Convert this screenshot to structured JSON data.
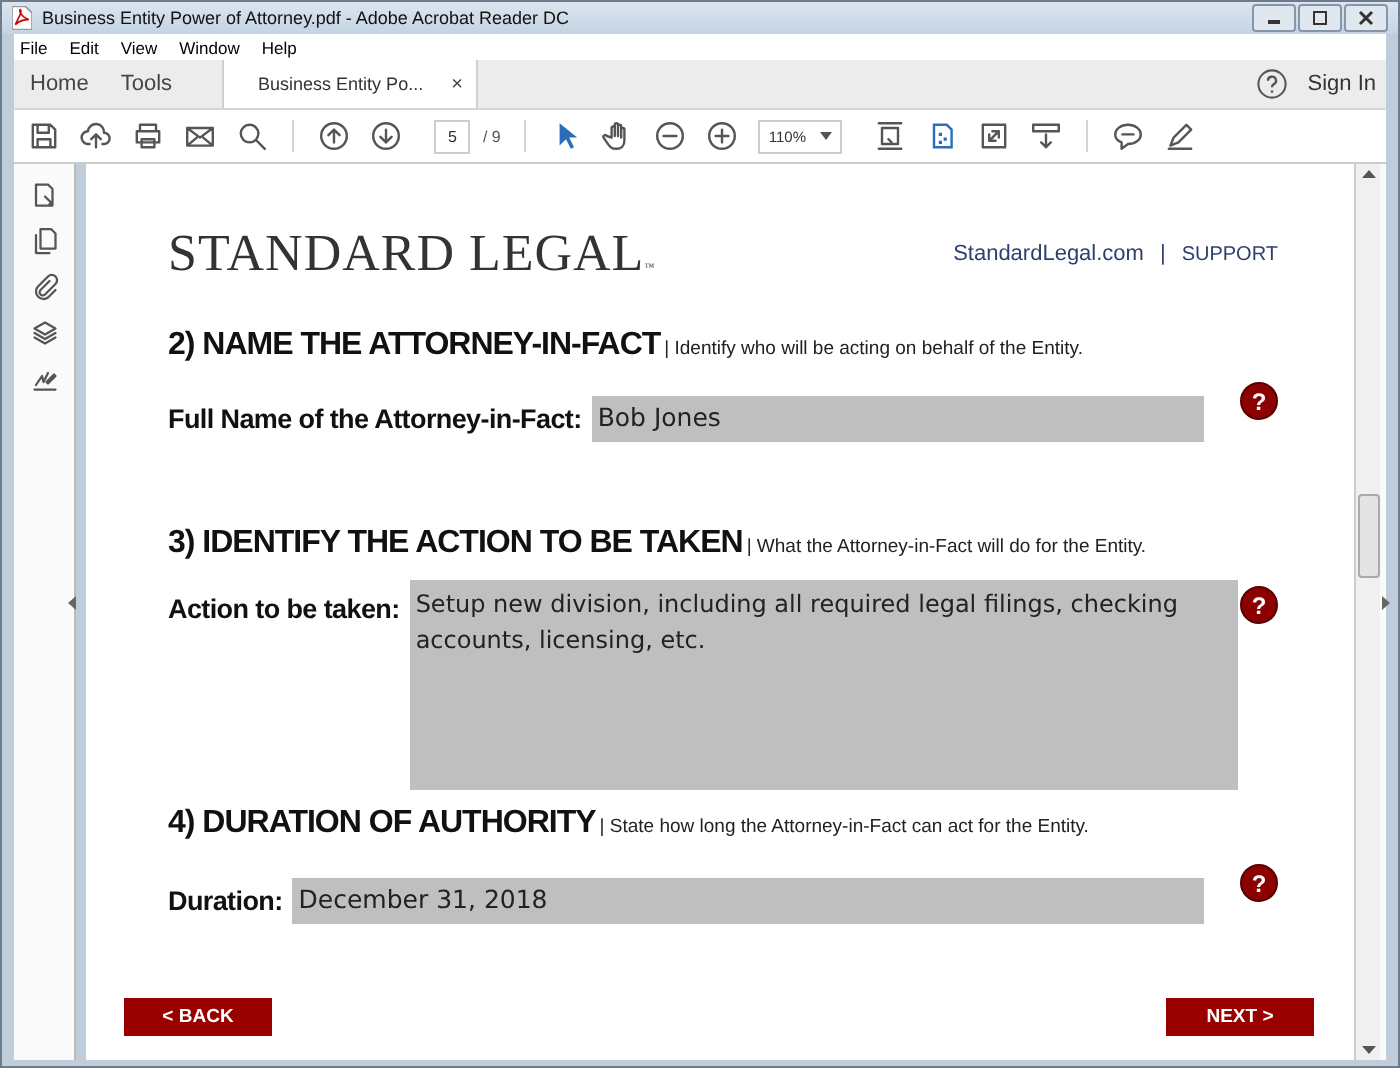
{
  "window": {
    "title": "Business Entity Power of Attorney.pdf - Adobe Acrobat Reader DC"
  },
  "menu": [
    "File",
    "Edit",
    "View",
    "Window",
    "Help"
  ],
  "tabs": [
    {
      "label": "Home",
      "selected": false
    },
    {
      "label": "Tools",
      "selected": false
    },
    {
      "label": "Business Entity Po...",
      "selected": true,
      "close": "×"
    }
  ],
  "sign_in": "Sign In",
  "toolbar": {
    "page": "5",
    "page_count": "/ 9",
    "zoom": "110%"
  },
  "document": {
    "logo": "STANDARD LEGAL",
    "logo_mark": "™",
    "links": [
      {
        "label": "StandardLegal.com"
      },
      {
        "label": "SUPPORT"
      }
    ],
    "link_separator": "|",
    "sections": [
      {
        "heading": "2) NAME THE ATTORNEY-IN-FACT",
        "hint": "| Identify who will be acting on behalf of the Entity.",
        "field": {
          "kind": "line",
          "label": "Full Name of the Attorney-in-Fact:",
          "value": "Bob Jones"
        },
        "help": "?"
      },
      {
        "heading": "3) IDENTIFY THE ACTION TO BE TAKEN",
        "hint": "| What the Attorney-in-Fact will do for the Entity.",
        "field": {
          "kind": "multiline",
          "label": "Action to be taken:",
          "value": "Setup new division, including all required legal filings, checking accounts, licensing, etc."
        },
        "help": "?"
      },
      {
        "heading": "4) DURATION OF AUTHORITY",
        "hint": "| State how long the Attorney-in-Fact can act for the Entity.",
        "field": {
          "kind": "line",
          "label": "Duration:",
          "value": "December 31, 2018"
        },
        "help": "?"
      }
    ],
    "buttons": [
      {
        "label": "< BACK"
      },
      {
        "label": "NEXT >"
      }
    ]
  }
}
